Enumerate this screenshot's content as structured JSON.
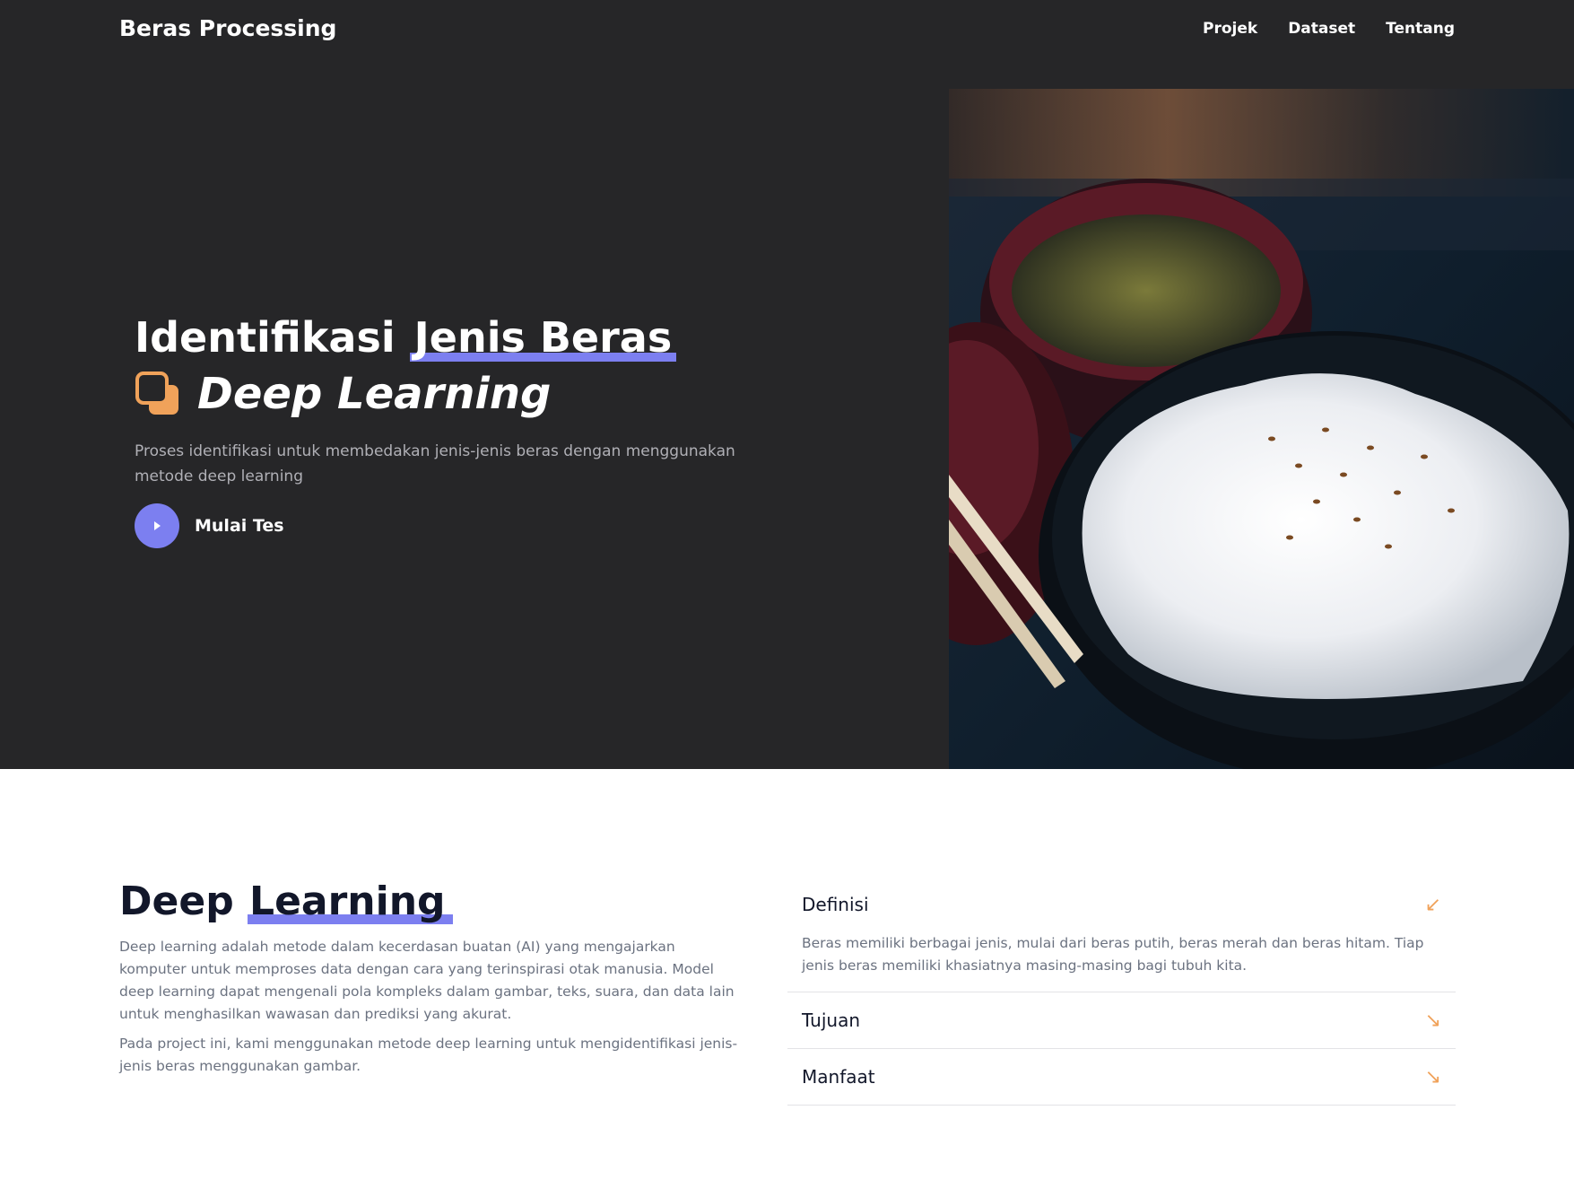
{
  "navbar": {
    "brand": "Beras Processing",
    "links": [
      "Projek",
      "Dataset",
      "Tentang"
    ]
  },
  "hero": {
    "title_plain": "Identifikasi ",
    "title_highlight": "Jenis Beras",
    "subtitle": "Deep Learning",
    "description": "Proses identifikasi untuk membedakan jenis-jenis beras dengan menggunakan metode deep learning",
    "cta_label": "Mulai Tes",
    "image_icon": "rice-bowl-photo"
  },
  "about": {
    "title_plain": "Deep ",
    "title_highlight": "Learning",
    "paragraphs": [
      "Deep learning adalah metode dalam kecerdasan buatan (AI) yang mengajarkan komputer untuk memproses data dengan cara yang terinspirasi otak manusia. Model deep learning dapat mengenali pola kompleks dalam gambar, teks, suara, dan data lain untuk menghasilkan wawasan dan prediksi yang akurat.",
      "Pada project ini, kami menggunakan metode deep learning untuk mengidentifikasi jenis-jenis beras menggunakan gambar."
    ]
  },
  "accordion": {
    "items": [
      {
        "title": "Definisi",
        "arrow": "↙",
        "body": "Beras memiliki berbagai jenis, mulai dari beras putih, beras merah dan beras hitam. Tiap jenis beras memiliki khasiatnya masing-masing bagi tubuh kita.",
        "expanded": true
      },
      {
        "title": "Tujuan",
        "arrow": "↘",
        "body": "",
        "expanded": false
      },
      {
        "title": "Manfaat",
        "arrow": "↘",
        "body": "",
        "expanded": false
      }
    ]
  },
  "colors": {
    "accent": "#7c7ff0",
    "orange": "#f0a25a",
    "hero_bg": "#262628"
  }
}
